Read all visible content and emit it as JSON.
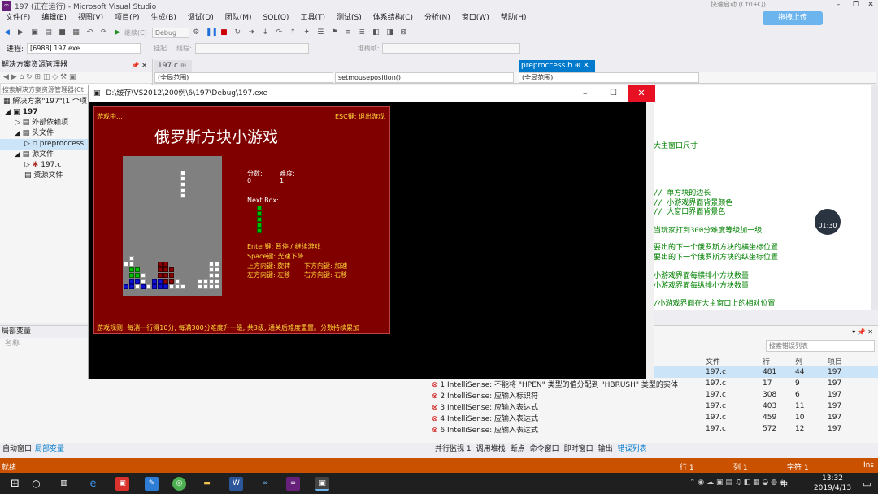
{
  "window": {
    "title": "197 (正在运行) - Microsoft Visual Studio",
    "quick_launch": "快速启动 (Ctrl+Q)",
    "cloud_button": "拖拽上传"
  },
  "menu": [
    "文件(F)",
    "编辑(E)",
    "视图(V)",
    "项目(P)",
    "生成(B)",
    "调试(D)",
    "团队(M)",
    "SQL(Q)",
    "工具(T)",
    "测试(S)",
    "体系结构(C)",
    "分析(N)",
    "窗口(W)",
    "帮助(H)"
  ],
  "toolbar": {
    "continue_label": "继续(C)",
    "config": "Debug"
  },
  "toolbar2": {
    "process_label": "进程:",
    "process_value": "[6988] 197.exe",
    "hang_label": "挂起",
    "thread_label": "线程:",
    "stack_label": "堆栈帧:"
  },
  "solution_explorer": {
    "title": "解决方案资源管理器",
    "search": "搜索解决方案资源管理器(Ct",
    "items": [
      "解决方案\"197\"(1 个项目)",
      "197",
      "外部依赖项",
      "头文件",
      "preproccess",
      "源文件",
      "197.c",
      "资源文件"
    ]
  },
  "editor": {
    "tab1": "197.c",
    "tab2": "preproccess.h",
    "nav_scope": "(全局范围)",
    "nav_func": "setmouseposition()",
    "nav_scope2": "(全局范围)"
  },
  "code_lines": [
    "大主窗口尺寸",
    "// 单方块的边长",
    "// 小游戏界面背景颜色",
    "// 大窗口界面背景色",
    "当玩家打到300分难度等级加一级",
    "要出的下一个俄罗斯方块的横坐标位置",
    "要出的下一个俄罗斯方块的纵坐标位置",
    "小游戏界面每横排小方块数量",
    "小游戏界面每纵排小方块数量",
    "/小游戏界面在大主窗口上的相对位置"
  ],
  "console": {
    "path": "D:\\缓存\\VS2012\\200例\\6\\197\\Debug\\197.exe"
  },
  "game": {
    "status": "游戏中...",
    "esc_hint": "ESC键: 退出游戏",
    "title": "俄罗斯方块小游戏",
    "score_label": "分数:",
    "score": "0",
    "level_label": "难度:",
    "level": "1",
    "next_label": "Next Box:",
    "controls": [
      "Enter键: 暂停 / 继续游戏",
      "Space键: 光速下降",
      "上方向键: 旋转",
      "下方向键: 加速",
      "左方向键: 左移",
      "右方向键: 右移"
    ],
    "rules": "游戏规则: 每消一行得10分, 每满300分难度升一级, 共3级, 通关后难度重置。分数持续累加"
  },
  "locals": {
    "title": "局部变量",
    "col_name": "名称"
  },
  "error_list": {
    "search": "搜索错误列表",
    "headers": [
      "文件",
      "行",
      "列",
      "项目"
    ],
    "rows": [
      {
        "desc": "",
        "file": "197.c",
        "line": "481",
        "col": "44",
        "proj": "197"
      },
      {
        "desc": "1  IntelliSense: 不能将 \"HPEN\" 类型的值分配到 \"HBRUSH\" 类型的实体",
        "file": "197.c",
        "line": "17",
        "col": "9",
        "proj": "197"
      },
      {
        "desc": "2  IntelliSense: 应输入标识符",
        "file": "197.c",
        "line": "308",
        "col": "6",
        "proj": "197"
      },
      {
        "desc": "3  IntelliSense: 应输入表达式",
        "file": "197.c",
        "line": "403",
        "col": "11",
        "proj": "197"
      },
      {
        "desc": "4  IntelliSense: 应输入表达式",
        "file": "197.c",
        "line": "459",
        "col": "10",
        "proj": "197"
      },
      {
        "desc": "6  IntelliSense: 应输入表达式",
        "file": "197.c",
        "line": "572",
        "col": "12",
        "proj": "197"
      }
    ]
  },
  "bottom_tabs_left": [
    "自动窗口",
    "局部变量"
  ],
  "bottom_tabs_right": [
    "并行监视 1",
    "调用堆栈",
    "断点",
    "命令窗口",
    "即时窗口",
    "输出",
    "错误列表"
  ],
  "status": {
    "state": "就绪",
    "line": "行 1",
    "col": "列 1",
    "char": "字符 1",
    "mode": "Ins"
  },
  "timer": "01:30",
  "taskbar": {
    "time": "13:32",
    "date": "2019/4/13",
    "ime": "中"
  }
}
